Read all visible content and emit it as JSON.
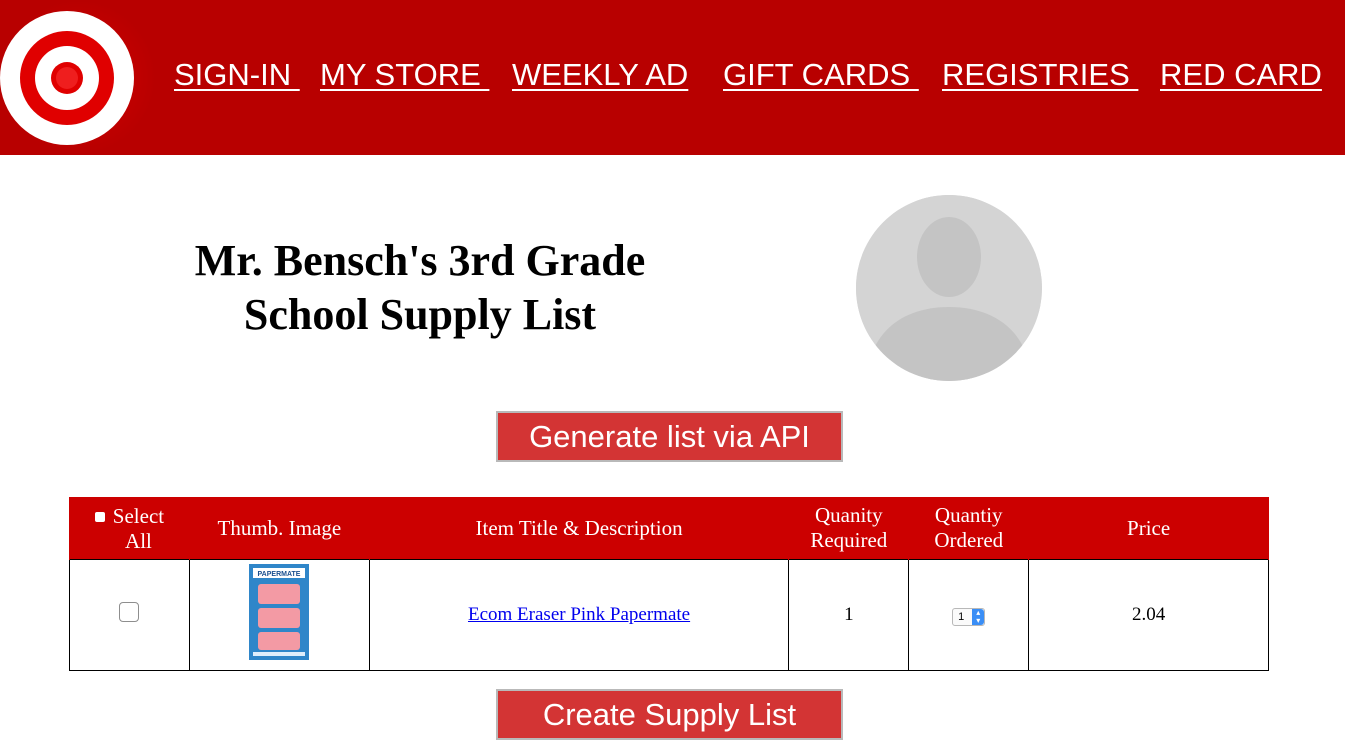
{
  "header": {
    "logo_icon": "target-bullseye-icon",
    "nav": [
      "SIGN-IN ",
      "MY STORE ",
      "WEEKLY AD",
      "GIFT CARDS ",
      "REGISTRIES ",
      "RED CARD"
    ]
  },
  "page": {
    "title_line1": "Mr. Bensch's 3rd Grade",
    "title_line2": "School Supply List",
    "avatar_icon": "user-avatar-placeholder-icon"
  },
  "buttons": {
    "generate": "Generate list via API",
    "create": "Create Supply List"
  },
  "table": {
    "headers": {
      "select_all_1": "Select",
      "select_all_2": "All",
      "thumb": "Thumb. Image",
      "title": "Item Title & Description",
      "qty_required_1": "Quanity",
      "qty_required_2": "Required",
      "qty_ordered_1": "Quantiy",
      "qty_ordered_2": "Ordered",
      "price": "Price"
    },
    "rows": [
      {
        "title": "Ecom Eraser Pink Papermate",
        "qty_required": "1",
        "qty_ordered": "1",
        "price": "2.04",
        "thumb_brand": "PAPERMATE"
      }
    ]
  },
  "colors": {
    "brand_red": "#b80000",
    "table_header": "#cc0000",
    "button": "#d33434"
  }
}
